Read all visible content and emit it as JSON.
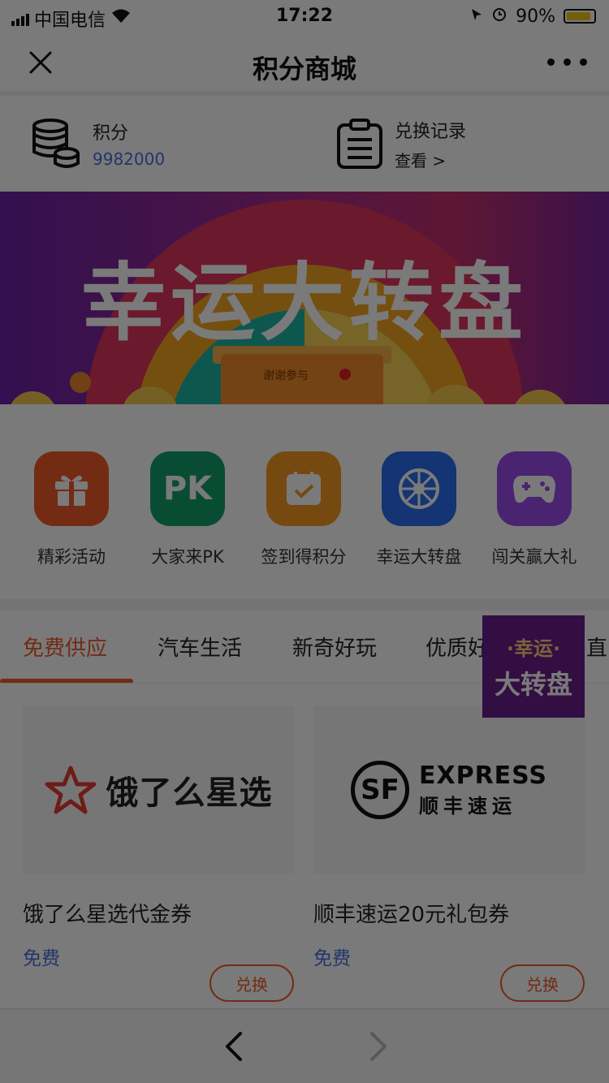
{
  "status_bar": {
    "carrier": "中国电信",
    "time": "17:22",
    "battery": "90%",
    "icons": [
      "signal-icon",
      "wifi-icon",
      "location-icon",
      "alarm-icon",
      "battery-icon"
    ]
  },
  "nav": {
    "title": "积分商城",
    "close_icon": "close-icon",
    "more_icon": "more-icon"
  },
  "points": {
    "label": "积分",
    "value": "9982000",
    "records_label": "兑换记录",
    "records_link": "查看 >"
  },
  "banner": {
    "title": "幸运大转盘",
    "gift_label": "谢谢参与"
  },
  "categories": [
    {
      "label": "精彩活动",
      "icon": "gift-icon",
      "color": "#f05a2a"
    },
    {
      "label": "大家来PK",
      "icon": "pk-icon",
      "color": "#14a06e"
    },
    {
      "label": "签到得积分",
      "icon": "checkin-icon",
      "color": "#f59a23"
    },
    {
      "label": "幸运大转盘",
      "icon": "wheel-icon",
      "color": "#2a6ef0"
    },
    {
      "label": "闯关赢大礼",
      "icon": "gamepad-icon",
      "color": "#9b4dea"
    }
  ],
  "tabs": [
    {
      "label": "免费供应",
      "active": true
    },
    {
      "label": "汽车生活",
      "active": false
    },
    {
      "label": "新奇好玩",
      "active": false
    },
    {
      "label": "优质好",
      "active": false
    },
    {
      "label": "直",
      "active": false
    }
  ],
  "float_badge": {
    "line1": "·幸运·",
    "line2": "大转盘"
  },
  "products": [
    {
      "logo_text": "饿了么星选",
      "name": "饿了么星选代金券",
      "price": "免费",
      "button": "兑换"
    },
    {
      "logo_mark": "SF",
      "logo_line1": "EXPRESS",
      "logo_line2": "顺丰速运",
      "name": "顺丰速运20元礼包券",
      "price": "免费",
      "button": "兑换"
    }
  ],
  "colors": {
    "accent": "#f05a2a",
    "link": "#4a6fe0",
    "overlay": "rgba(0,0,0,0.52)"
  }
}
